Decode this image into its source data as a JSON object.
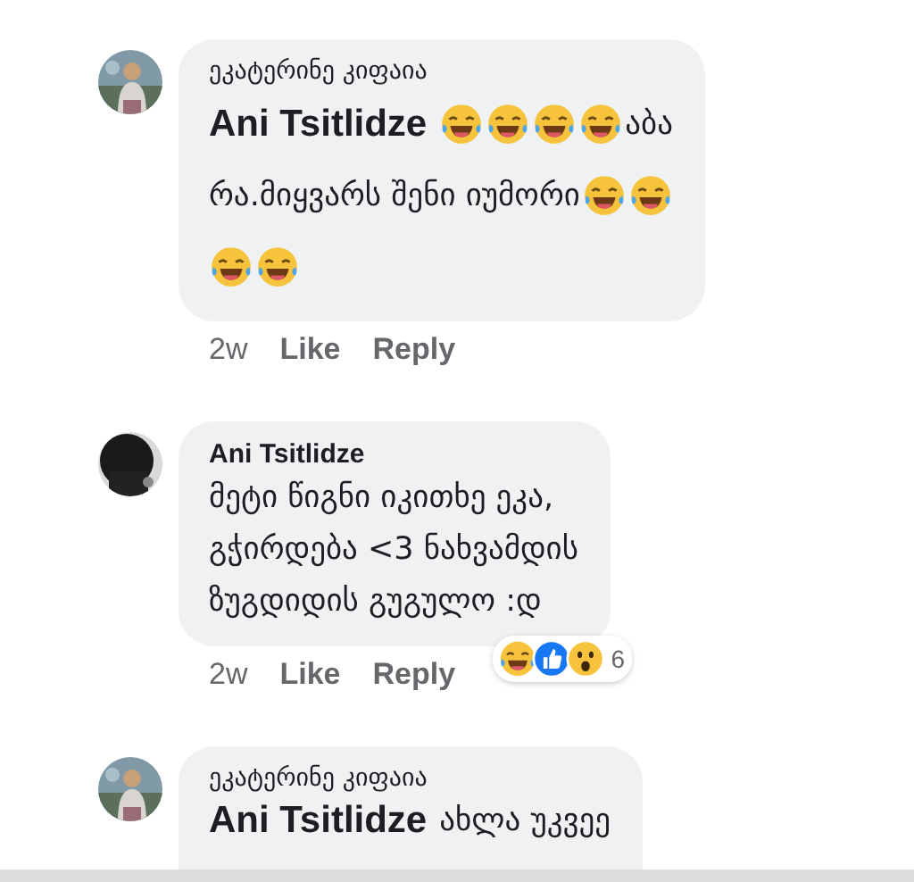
{
  "comments": [
    {
      "author": "ეკატერინე კიფაია",
      "author_bold": false,
      "lines": [
        [
          {
            "kind": "mention",
            "text": "Ani Tsitlidze"
          },
          {
            "kind": "emoji"
          },
          {
            "kind": "emoji"
          },
          {
            "kind": "emoji"
          },
          {
            "kind": "emoji"
          },
          {
            "kind": "text",
            "text": "აბა"
          }
        ],
        [
          {
            "kind": "text",
            "text": "რა.მიყვარს შენი იუმორი"
          },
          {
            "kind": "emoji"
          },
          {
            "kind": "emoji"
          }
        ],
        [
          {
            "kind": "emoji"
          },
          {
            "kind": "emoji"
          }
        ]
      ],
      "time": "2w",
      "actions": [
        "Like",
        "Reply"
      ]
    },
    {
      "author": "Ani Tsitlidze",
      "author_bold": true,
      "lines": [
        [
          {
            "kind": "text",
            "text": "მეტი წიგნი იკითხე ეკა,"
          }
        ],
        [
          {
            "kind": "text",
            "text": "გჭირდება <3 ნახვამდის"
          }
        ],
        [
          {
            "kind": "text",
            "text": "ზუგდიდის გუგულო :დ"
          }
        ]
      ],
      "time": "2w",
      "actions": [
        "Like",
        "Reply"
      ],
      "reactions": {
        "icons": [
          {
            "kind": "haha"
          },
          {
            "kind": "like"
          },
          {
            "kind": "wow"
          }
        ],
        "count": "6"
      }
    },
    {
      "author": "ეკატერინე კიფაია",
      "author_bold": false,
      "lines": [
        [
          {
            "kind": "mention",
            "text": "Ani Tsitlidze"
          },
          {
            "kind": "text",
            "text": "ახლა უკვეე"
          }
        ]
      ]
    }
  ]
}
